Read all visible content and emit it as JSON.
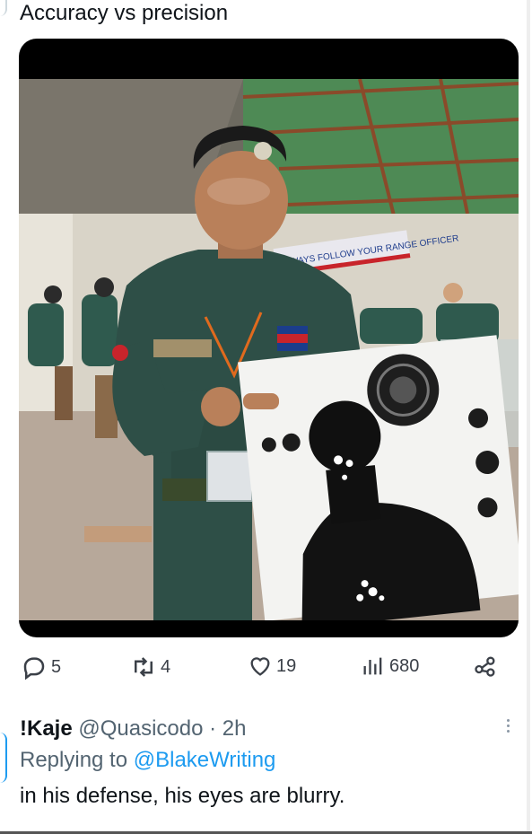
{
  "tweet": {
    "title": "Accuracy vs precision",
    "metrics": {
      "replies": "5",
      "retweets": "4",
      "likes": "19",
      "views": "680"
    }
  },
  "image": {
    "banner_text": "ALWAYS FOLLOW YOUR RANGE OFFICER",
    "icon": "photo-soldier-with-target"
  },
  "reply": {
    "name": "!Kaje",
    "handle": "@Quasicodo",
    "time": "· 2h",
    "replying_prefix": "Replying to",
    "replying_to": "@BlakeWriting",
    "text": "in his defense, his eyes are blurry."
  },
  "colors": {
    "accent": "#1d9bf0",
    "text": "#0f1419",
    "muted": "#536471"
  }
}
